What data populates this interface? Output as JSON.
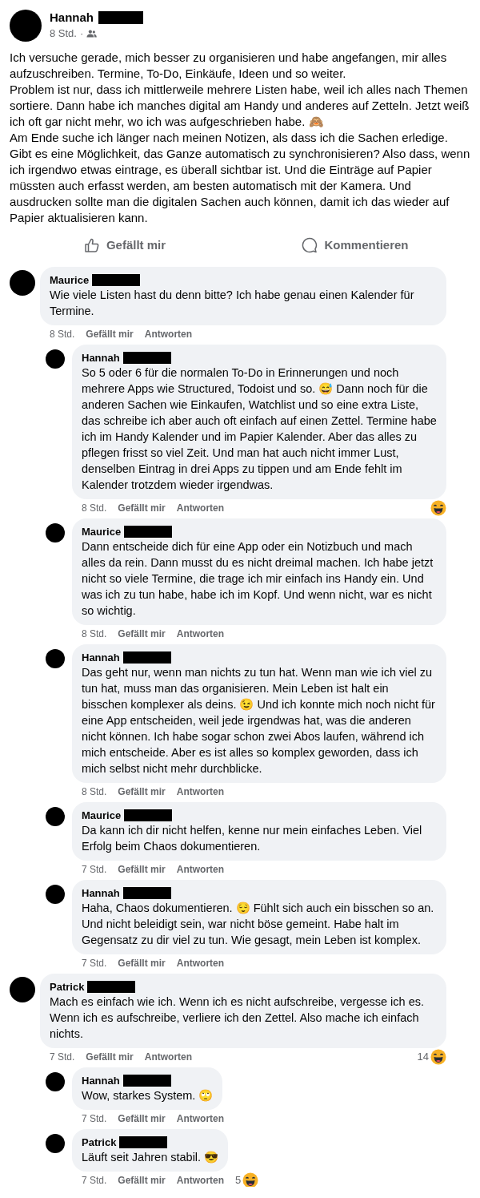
{
  "post": {
    "author": "Hannah",
    "time": "8 Std.",
    "separator": "·",
    "text": "Ich versuche gerade, mich besser zu organisieren und habe angefangen, mir alles aufzuschreiben. Termine, To-Do, Einkäufe, Ideen und so weiter.\nProblem ist nur, dass ich mittlerweile mehrere Listen habe, weil ich alles nach Themen sortiere. Dann habe ich manches digital am Handy und anderes auf Zetteln. Jetzt weiß ich oft gar nicht mehr, wo ich was aufgeschrieben habe. 🙈\nAm Ende suche ich länger nach meinen Notizen, als dass ich die Sachen erledige. Gibt es eine Möglichkeit, das Ganze automatisch zu synchronisieren? Also dass, wenn ich irgendwo etwas eintrage, es überall sichtbar ist. Und die Einträge auf Papier müssten auch erfasst werden, am besten automatisch mit der Kamera. Und ausdrucken sollte man die digitalen Sachen auch können, damit ich das wieder auf Papier aktualisieren kann.",
    "actions": [
      {
        "kind": "like",
        "label": "Gefällt mir"
      },
      {
        "kind": "comment",
        "label": "Kommentieren"
      }
    ]
  },
  "comments": [
    {
      "author": "Maurice",
      "text": "Wie viele Listen hast du denn bitte? Ich habe genau einen Kalender für Termine.",
      "time": "8 Std.",
      "actions": [
        "Gefällt mir",
        "Antworten"
      ],
      "children": [
        {
          "author": "Hannah",
          "text": "So 5 oder 6 für die normalen To-Do in Erinnerungen und noch mehrere Apps wie Structured, Todoist und so. 😅 Dann noch für die anderen Sachen wie Einkaufen, Watchlist und so eine extra Liste, das schreibe ich aber auch oft einfach auf einen Zettel. Termine habe ich im Handy Kalender und im Papier Kalender. Aber das alles zu pflegen frisst so viel Zeit. Und man hat auch nicht immer Lust, denselben Eintrag in drei Apps zu tippen und am Ende fehlt im Kalender trotzdem wieder irgendwas.",
          "time": "8 Std.",
          "actions": [
            "Gefällt mir",
            "Antworten"
          ],
          "reacted": true
        },
        {
          "author": "Maurice",
          "text": "Dann entscheide dich für eine App oder ein Notizbuch und mach alles da rein. Dann musst du es nicht dreimal machen. Ich habe jetzt nicht so viele Termine, die trage ich mir einfach ins Handy ein. Und was ich zu tun habe, habe ich im Kopf. Und wenn nicht, war es nicht so wichtig.",
          "time": "8 Std.",
          "actions": [
            "Gefällt mir",
            "Antworten"
          ]
        },
        {
          "author": "Hannah",
          "text": "Das geht nur, wenn man nichts zu tun hat. Wenn man wie ich viel zu tun hat, muss man das organisieren. Mein Leben ist halt ein bisschen komplexer als deins. 😉 Und ich konnte mich noch nicht für eine App entscheiden, weil jede irgendwas hat, was die anderen nicht können. Ich habe sogar schon zwei Abos laufen, während ich mich entscheide. Aber es ist alles so komplex geworden, dass ich mich selbst nicht mehr durchblicke.",
          "time": "8 Std.",
          "actions": [
            "Gefällt mir",
            "Antworten"
          ]
        },
        {
          "author": "Maurice",
          "text": "Da kann ich dir nicht helfen, kenne nur mein einfaches Leben. Viel Erfolg beim Chaos dokumentieren.",
          "time": "7 Std.",
          "actions": [
            "Gefällt mir",
            "Antworten"
          ]
        },
        {
          "author": "Hannah",
          "text": "Haha, Chaos dokumentieren. 😌 Fühlt sich auch ein bisschen so an. Und nicht beleidigt sein, war nicht böse gemeint. Habe halt im Gegensatz zu dir viel zu tun. Wie gesagt, mein Leben ist komplex.",
          "time": "7 Std.",
          "actions": [
            "Gefällt mir",
            "Antworten"
          ]
        }
      ]
    },
    {
      "author": "Patrick",
      "text": "Mach es einfach wie ich. Wenn ich es nicht aufschreibe, vergesse ich es. Wenn ich es aufschreibe, verliere ich den Zettel. Also mache ich einfach nichts.",
      "time": "7 Std.",
      "actions": [
        "Gefällt mir",
        "Antworten"
      ],
      "reacted": true,
      "reaction_count": "14",
      "children": [
        {
          "author": "Hannah",
          "text": "Wow, starkes System. 🙄",
          "time": "7 Std.",
          "actions": [
            "Gefällt mir",
            "Antworten"
          ]
        },
        {
          "author": "Patrick",
          "text": "Läuft seit Jahren stabil. 😎",
          "time": "7 Std.",
          "actions": [
            "Gefällt mir",
            "Antworten"
          ],
          "reacted": true,
          "reaction_count": "5"
        }
      ]
    }
  ]
}
